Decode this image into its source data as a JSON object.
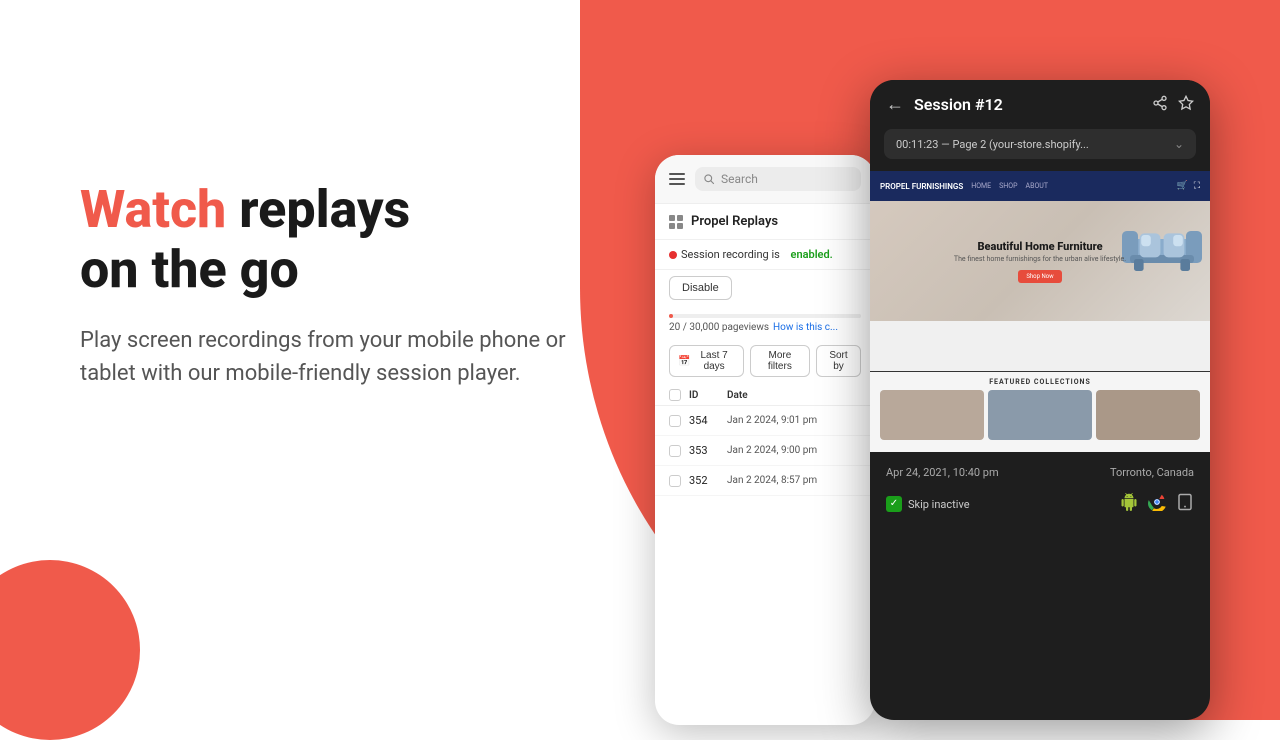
{
  "background": {
    "coral_color": "#F05A4B"
  },
  "left": {
    "headline_watch": "Watch",
    "headline_rest": " replays\non the go",
    "subtext": "Play screen recordings from your mobile phone or tablet with our mobile-friendly session player."
  },
  "phone_left": {
    "search_placeholder": "Search",
    "app_name": "Propel Replays",
    "session_status_label": "Session recording is",
    "session_status_value": "enabled.",
    "disable_button": "Disable",
    "progress_text": "20 / 30,000 pageviews",
    "progress_link": "How is this c...",
    "filter_last7": "Last 7 days",
    "filter_more": "More filters",
    "sort_by": "Sort by",
    "table_headers": [
      "ID",
      "Date"
    ],
    "rows": [
      {
        "id": "354",
        "date": "Jan 2 2024, 9:01 pm"
      },
      {
        "id": "353",
        "date": "Jan 2 2024, 9:00 pm"
      },
      {
        "id": "352",
        "date": "Jan 2 2024, 8:57 pm"
      }
    ]
  },
  "phone_right": {
    "session_title": "Session #12",
    "url_bar": "00:11:23 — Page 2 (your-store.shopify...",
    "hero_title": "Beautiful Home Furniture",
    "hero_sub": "The finest home furnishings for the urban alive lifestyle.",
    "hero_btn": "Shop Now",
    "featured_title": "FEATURED COLLECTIONS",
    "session_date": "Apr 24, 2021, 10:40 pm",
    "session_location": "Torronto, Canada",
    "skip_inactive_label": "Skip inactive",
    "platform_icons": [
      "android",
      "chrome",
      "tablet"
    ]
  }
}
